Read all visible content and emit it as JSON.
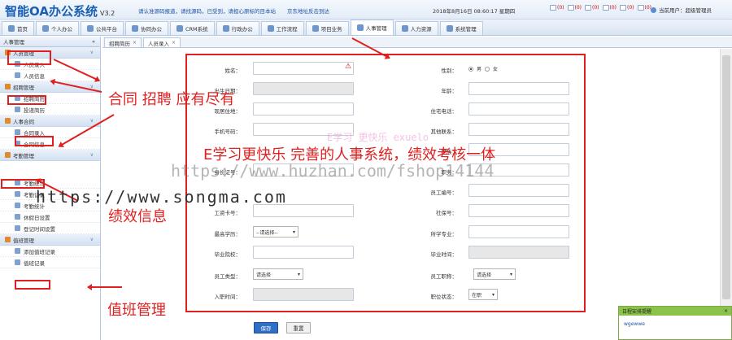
{
  "header": {
    "logo": "智能OA办公系统",
    "version": "V3.2",
    "marquee_a": "请认准源码报道，请找源码，已受到，请担心原标的目本站",
    "marquee_b": "京东地址反击到达",
    "datetime": "2018年8月16日 08:60:17 星期四",
    "badges": [
      {
        "icon": "mail-icon",
        "count": "(0)"
      },
      {
        "icon": "notice-icon",
        "count": "(0)"
      },
      {
        "icon": "task-icon",
        "count": "(0)"
      },
      {
        "icon": "meeting-icon",
        "count": "(0)"
      },
      {
        "icon": "plan-icon",
        "count": "(0)"
      },
      {
        "icon": "alert-icon",
        "count": "(0)"
      }
    ],
    "user": "当前用户：超级管理员"
  },
  "nav": [
    {
      "label": "首页"
    },
    {
      "label": "个人办公"
    },
    {
      "label": "公共平台"
    },
    {
      "label": "协同办公"
    },
    {
      "label": "CRM系统"
    },
    {
      "label": "行政办公"
    },
    {
      "label": "工作流程"
    },
    {
      "label": "项目业务"
    },
    {
      "label": "人事管理"
    },
    {
      "label": "人力资源"
    },
    {
      "label": "系统管理"
    }
  ],
  "sidebar": {
    "title": "人事管理",
    "collapse": "«",
    "groups": [
      {
        "label": "人员管理",
        "items": [
          "人员录入",
          "人员信息"
        ]
      },
      {
        "label": "招聘管理",
        "items": [
          "招聘简历",
          "投递简历"
        ]
      },
      {
        "label": "人事合同",
        "items": [
          "合同录入",
          "合同信息"
        ]
      },
      {
        "label": "考勤管理",
        "items": [
          "考勤统计",
          "考勤记录",
          "考勤统计",
          "休假日设置",
          "登记时间设置"
        ]
      },
      {
        "label": "值班管理",
        "items": [
          "添加值班记录",
          "值班记录"
        ]
      }
    ]
  },
  "tabs": [
    {
      "label": "招聘简历",
      "close": "×"
    },
    {
      "label": "人员录入",
      "close": "×"
    }
  ],
  "form": {
    "labels": {
      "name": "姓名：",
      "gender": "性别：",
      "birthday": "出生日期：",
      "age": "年龄：",
      "home_addr": "现居住地：",
      "home_phone": "住宅电话：",
      "mobile": "手机号码：",
      "other_contact": "其他联系：",
      "nation": "民族：",
      "dept": "部门：",
      "id_card": "身份证号：",
      "position": "职务：",
      "emp_no": "员工编号：",
      "work_no": "工资卡号：",
      "social_no": "社保号：",
      "education": "最高学历：",
      "major": "所学专业：",
      "school": "毕业院校：",
      "grad_time": "毕业时间：",
      "emp_type": "员工类型：",
      "emp_role": "员工职称：",
      "hire_time": "入职时间：",
      "status": "职位状态："
    },
    "gender_male": "男",
    "gender_female": "女",
    "education_value": "--请选择--",
    "emp_type_value": "请选择",
    "emp_role_value": "请选择",
    "status_value": "在职",
    "save": "保存",
    "reset": "重置"
  },
  "annotations": {
    "contract": "合同 招聘 应有尽有",
    "main": "E学习更快乐 完善的人事系统，绩效考核一体",
    "perf": "绩效信息",
    "duty": "值班管理"
  },
  "watermarks": {
    "w1": "https://www.huzhan.com/fshop14144",
    "w2": "https://www.songma.com",
    "w3": "E学习 更快乐 exuelo"
  },
  "popup": {
    "title": "日程安排提醒",
    "close": "×",
    "body": "wgewwe"
  }
}
